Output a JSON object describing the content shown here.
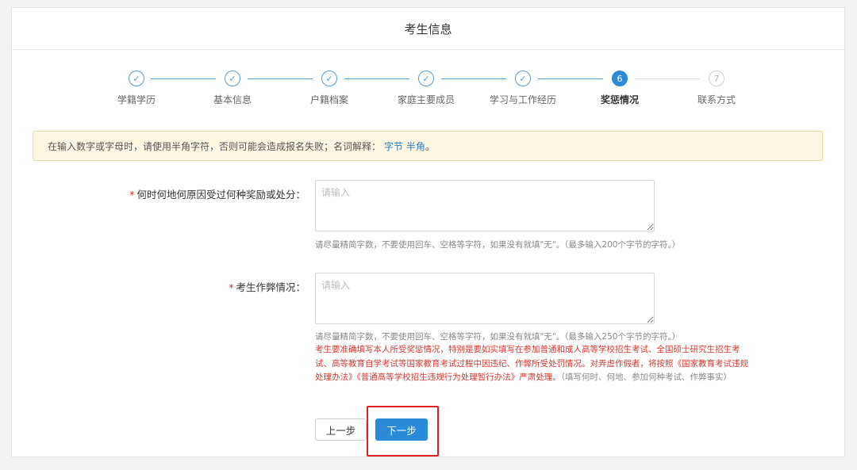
{
  "header": {
    "title": "考生信息"
  },
  "steps": [
    {
      "number": "✓",
      "label": "学籍学历",
      "state": "done"
    },
    {
      "number": "✓",
      "label": "基本信息",
      "state": "done"
    },
    {
      "number": "✓",
      "label": "户籍档案",
      "state": "done"
    },
    {
      "number": "✓",
      "label": "家庭主要成员",
      "state": "done"
    },
    {
      "number": "✓",
      "label": "学习与工作经历",
      "state": "done"
    },
    {
      "number": "6",
      "label": "奖惩情况",
      "state": "active"
    },
    {
      "number": "7",
      "label": "联系方式",
      "state": "todo"
    }
  ],
  "notice": {
    "text": "在输入数字或字母时，请使用半角字符，否则可能会造成报名失败；名词解释：",
    "link1": "字节",
    "link2": "半角",
    "end": "。"
  },
  "form": {
    "field1": {
      "label": "何时何地何原因受过何种奖励或处分：",
      "placeholder": "请输入",
      "value": "",
      "hint": "请尽量精简字数，不要使用回车、空格等字符，如果没有就填\"无\"。（最多输入200个字节的字符。）"
    },
    "field2": {
      "label": "考生作弊情况：",
      "placeholder": "请输入",
      "value": "",
      "hint": "请尽量精简字数，不要使用回车、空格等字符，如果没有就填\"无\"。（最多输入250个字节的字符。）"
    },
    "warning": "考生要准确填写本人所受奖惩情况，特别是要如实填写在参加普通和成人高等学校招生考试、全国硕士研究生招生考试、高等教育自学考试等国家教育考试过程中因违纪、作弊所受处罚情况。对弄虚作假者，将按照《国家教育考试违规处理办法》《普通高等学校招生违规行为处理暂行办法》严肃处理。",
    "warning_note": "（填写何时、何地、参加何种考试、作弊事实）",
    "required_mark": "*"
  },
  "buttons": {
    "prev": "上一步",
    "next": "下一步"
  },
  "colors": {
    "primary": "#2b8bd8",
    "required": "#d0342c",
    "highlight": "#e02020"
  }
}
